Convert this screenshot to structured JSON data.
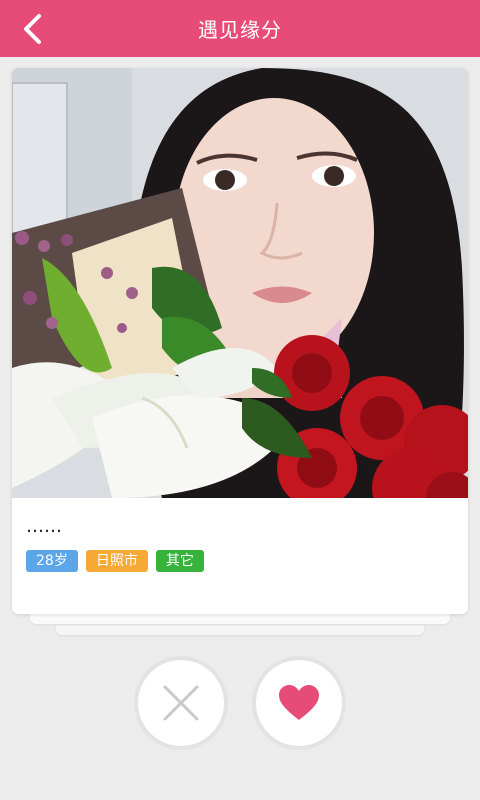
{
  "header": {
    "title": "遇见缘分",
    "back_icon": "chevron-left-icon"
  },
  "profile": {
    "photo_alt": "profile photo",
    "intro": "……",
    "tags": {
      "age": "28岁",
      "city": "日照市",
      "job": "其它"
    }
  },
  "actions": {
    "dislike_icon": "close-icon",
    "like_icon": "heart-icon"
  },
  "colors": {
    "brand": "#e74c79",
    "tag_age": "#5aa6e8",
    "tag_city": "#f7a935",
    "tag_job": "#37b23b"
  }
}
